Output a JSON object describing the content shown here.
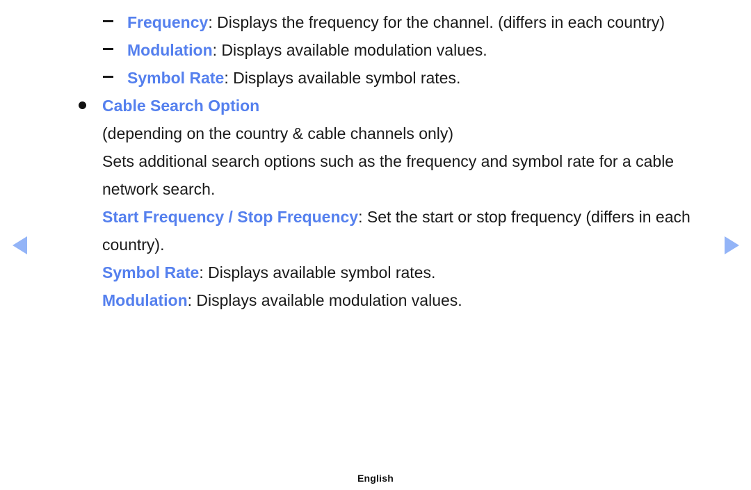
{
  "page": {
    "language_footer": "English",
    "accent_color": "#5580ee",
    "text_color": "#1a1a1a",
    "background_color": "#ffffff",
    "arrow_color": "#93b4f7"
  },
  "nav": {
    "prev_icon": "triangle-left-icon",
    "next_icon": "triangle-right-icon"
  },
  "content": {
    "dash_items": [
      {
        "marker": "dash-marker",
        "term": "Frequency",
        "separator": ": ",
        "description": "Displays the frequency for the channel. (differs in each country)"
      },
      {
        "marker": "dash-marker",
        "term": "Modulation",
        "separator": ": ",
        "description": "Displays available modulation values."
      },
      {
        "marker": "dash-marker",
        "term": "Symbol Rate",
        "separator": ": ",
        "description": "Displays available symbol rates."
      }
    ],
    "bullet_item": {
      "marker": "bullet-marker",
      "heading": "Cable Search Option"
    },
    "paragraphs": [
      "(depending on the country & cable channels only)",
      "Sets additional search options such as the frequency and symbol rate for a cable network search."
    ],
    "sub_entries": [
      {
        "term": "Start Frequency / Stop Frequency",
        "separator": ": ",
        "description": "Set the start or stop frequency (differs in each country)."
      },
      {
        "term": "Symbol Rate",
        "separator": ": ",
        "description": "Displays available symbol rates."
      },
      {
        "term": "Modulation",
        "separator": ": ",
        "description": "Displays available modulation values."
      }
    ]
  }
}
